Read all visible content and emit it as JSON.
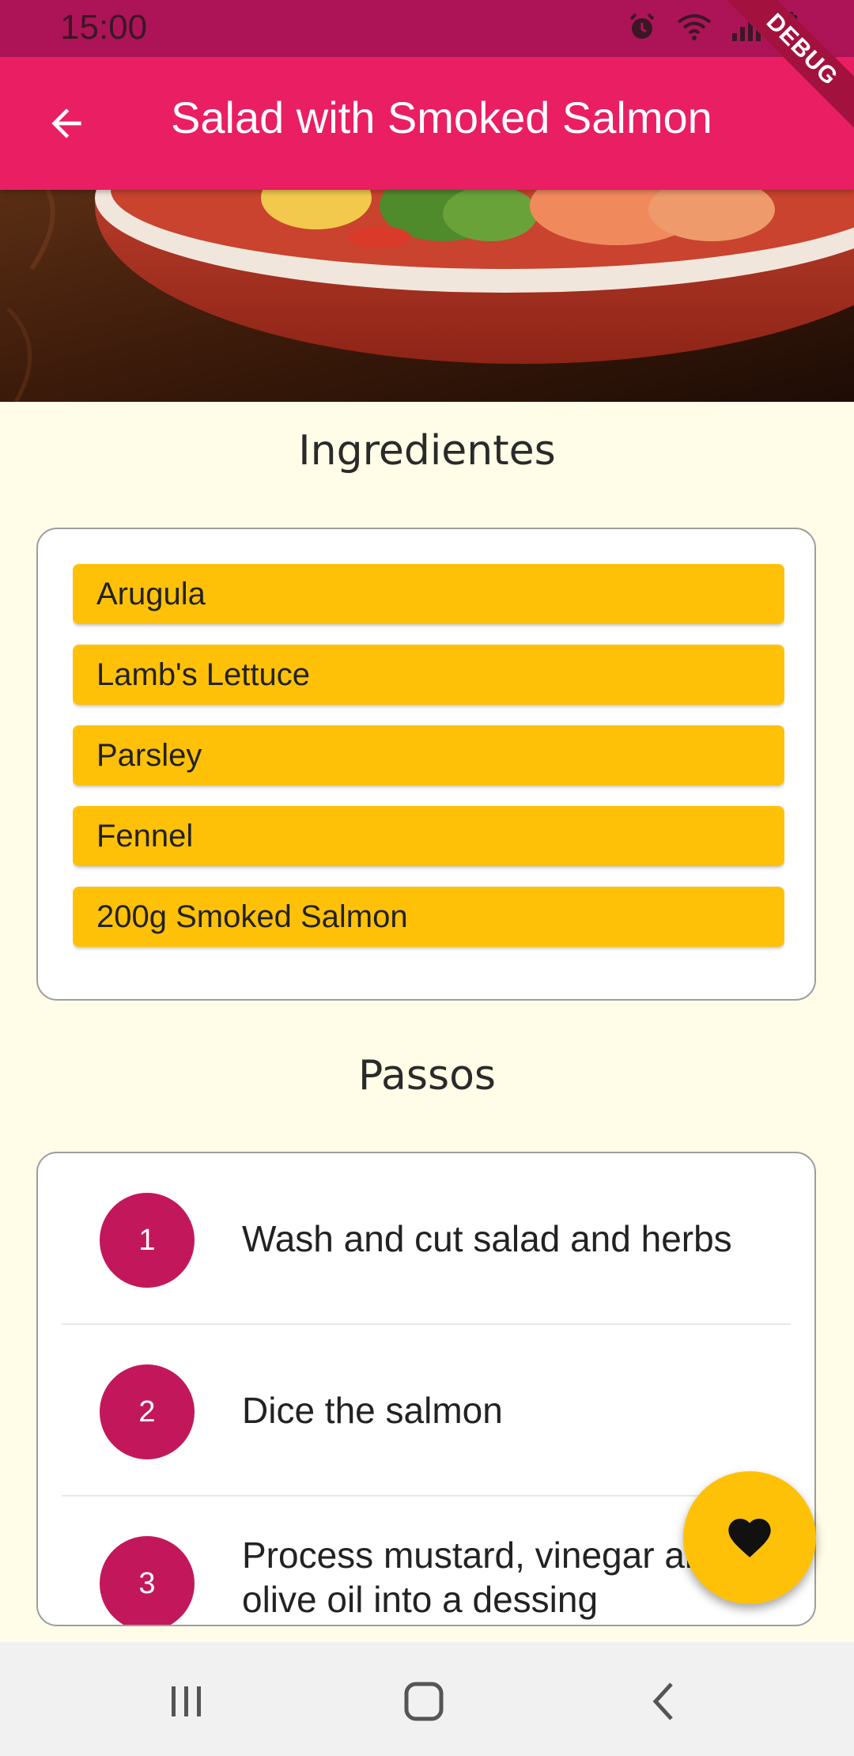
{
  "status_bar": {
    "time": "15:00",
    "icons": [
      "alarm-icon",
      "wifi-icon",
      "signal-icon",
      "battery-icon"
    ]
  },
  "app_bar": {
    "title": "Salad with Smoked Salmon",
    "back_icon": "arrow-back-icon",
    "debug_label": "DEBUG",
    "color": "#e91e63"
  },
  "ingredients": {
    "title": "Ingredientes",
    "items": [
      "Arugula",
      "Lamb's Lettuce",
      "Parsley",
      "Fennel",
      "200g Smoked Salmon"
    ],
    "item_color": "#ffc107"
  },
  "steps": {
    "title": "Passos",
    "items": [
      {
        "number": "1",
        "text": "Wash and cut salad and herbs"
      },
      {
        "number": "2",
        "text": "Dice the salmon"
      },
      {
        "number": "3",
        "text": "Process mustard, vinegar and olive oil into a dessing"
      }
    ],
    "avatar_color": "#c2185b"
  },
  "fab": {
    "icon": "heart-icon",
    "color": "#ffc107"
  },
  "nav": {
    "icons": [
      "recent-apps-icon",
      "home-icon",
      "back-nav-icon"
    ]
  }
}
